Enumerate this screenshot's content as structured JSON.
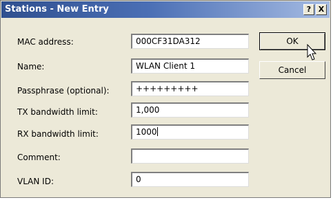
{
  "window": {
    "title": "Stations - New Entry",
    "help_label": "?",
    "close_label": "X"
  },
  "fields": [
    {
      "label": "MAC address:",
      "value": "000CF31DA312"
    },
    {
      "label": "Name:",
      "value": "WLAN Client 1"
    },
    {
      "label": "Passphrase (optional):",
      "value": "+++++++++"
    },
    {
      "label": "TX bandwidth limit:",
      "value": "1,000"
    },
    {
      "label": "RX bandwidth limit:",
      "value": "1000"
    },
    {
      "label": "Comment:",
      "value": ""
    },
    {
      "label": "VLAN ID:",
      "value": "0"
    }
  ],
  "buttons": {
    "ok_label": "OK",
    "cancel_label": "Cancel"
  },
  "icons": {
    "help": "help-icon",
    "close": "close-icon",
    "cursor": "mouse-pointer-icon"
  },
  "colors": {
    "titlebar_start": "#2f4f8f",
    "titlebar_end": "#a6bce3",
    "dialog_bg": "#ece9d8"
  }
}
